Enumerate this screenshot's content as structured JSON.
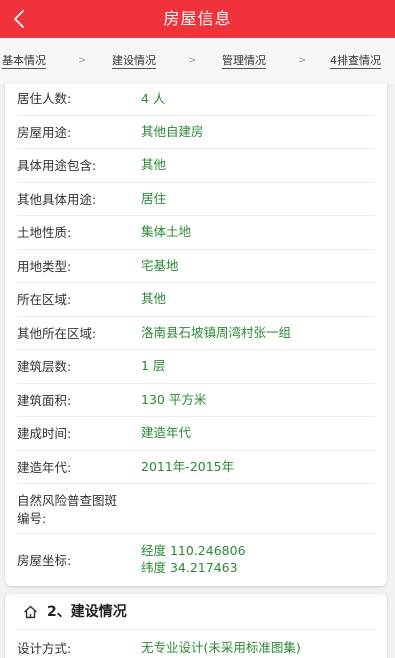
{
  "header": {
    "title": "房屋信息",
    "back_icon": "chevron-left-icon"
  },
  "steps": {
    "items": [
      "基本情况",
      "建设情况",
      "管理情况",
      "4排查情况"
    ],
    "separator": ">"
  },
  "details": {
    "rows": [
      {
        "label": "居住人数:",
        "value": "4 人"
      },
      {
        "label": "房屋用途:",
        "value": "其他自建房"
      },
      {
        "label": "具体用途包含:",
        "value": "其他"
      },
      {
        "label": "其他具体用途:",
        "value": "居住"
      },
      {
        "label": "土地性质:",
        "value": "集体土地"
      },
      {
        "label": "用地类型:",
        "value": "宅基地"
      },
      {
        "label": "所在区域:",
        "value": "其他"
      },
      {
        "label": "其他所在区域:",
        "value": "洛南县石坡镇周湾村张一组"
      },
      {
        "label": "建筑层数:",
        "value": "1 层"
      },
      {
        "label": "建筑面积:",
        "value": "130 平方米"
      },
      {
        "label": "建成时间:",
        "value": "建造年代"
      },
      {
        "label": "建造年代:",
        "value": "2011年-2015年"
      },
      {
        "label_line1": "自然风险普查图斑",
        "label_line2": "编号:",
        "value": ""
      },
      {
        "label": "房屋坐标:",
        "value_line1": "经度 110.246806",
        "value_line2": "纬度 34.217463"
      }
    ]
  },
  "construction": {
    "section_title": "2、建设情况",
    "section_icon": "home-icon",
    "rows": [
      {
        "label": "设计方式:",
        "value": "无专业设计(未采用标准图集)"
      }
    ]
  },
  "colors": {
    "header_bg": "#f0323a",
    "value_text": "#2c8a34"
  }
}
